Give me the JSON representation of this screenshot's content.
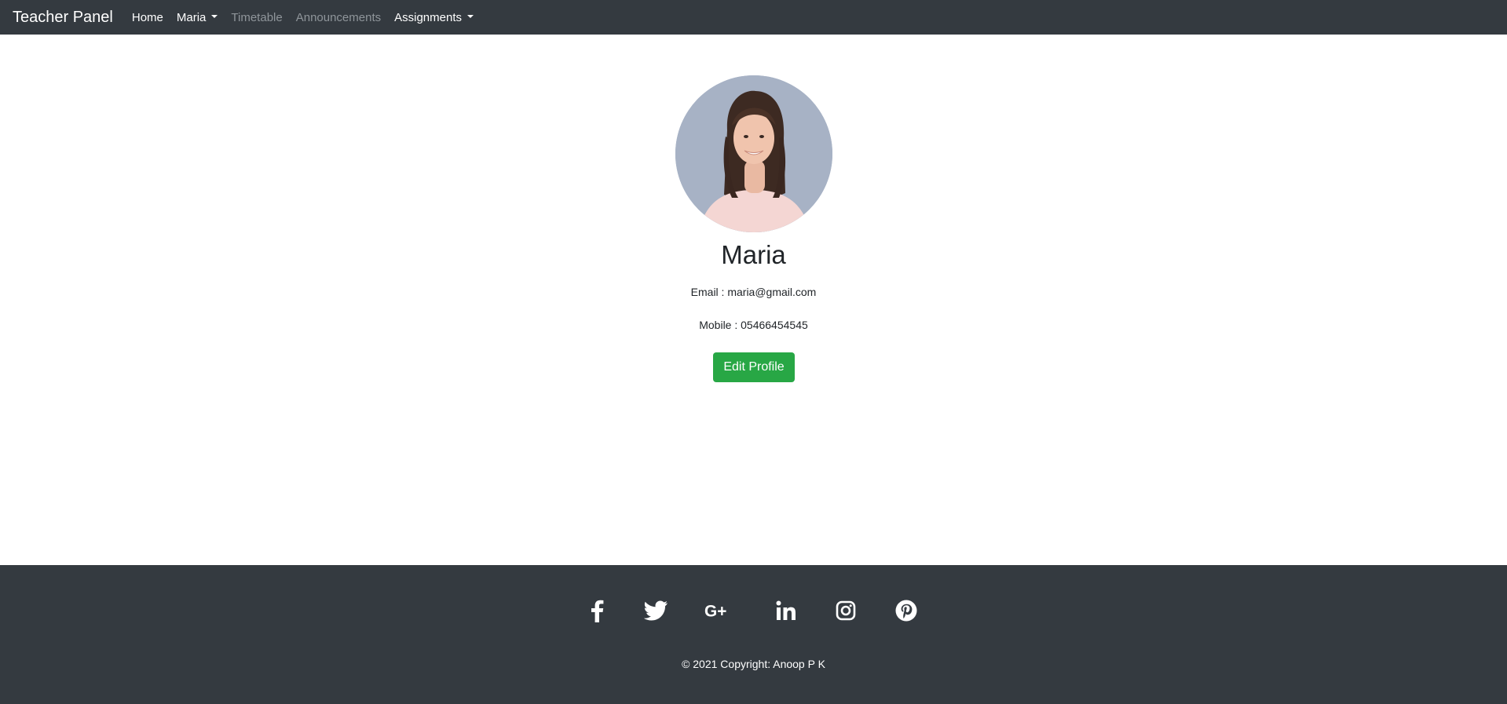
{
  "navbar": {
    "brand": "Teacher Panel",
    "items": [
      {
        "label": "Home",
        "state": "active"
      },
      {
        "label": "Maria",
        "state": "active",
        "dropdown": true
      },
      {
        "label": "Timetable",
        "state": "muted"
      },
      {
        "label": "Announcements",
        "state": "muted"
      },
      {
        "label": "Assignments",
        "state": "active",
        "dropdown": true
      }
    ]
  },
  "profile": {
    "avatar_alt": "profile photo",
    "name": "Maria",
    "email_line": "Email : maria@gmail.com",
    "mobile_line": "Mobile : 05466454545",
    "edit_button": "Edit Profile"
  },
  "footer": {
    "social_icons": [
      "facebook-icon",
      "twitter-icon",
      "google-plus-icon",
      "linkedin-icon",
      "instagram-icon",
      "pinterest-icon"
    ],
    "copyright": "© 2021 Copyright: Anoop P K"
  },
  "colors": {
    "navbar_bg": "#343a40",
    "button_green": "#28a745",
    "muted_link": "#8f959a"
  }
}
